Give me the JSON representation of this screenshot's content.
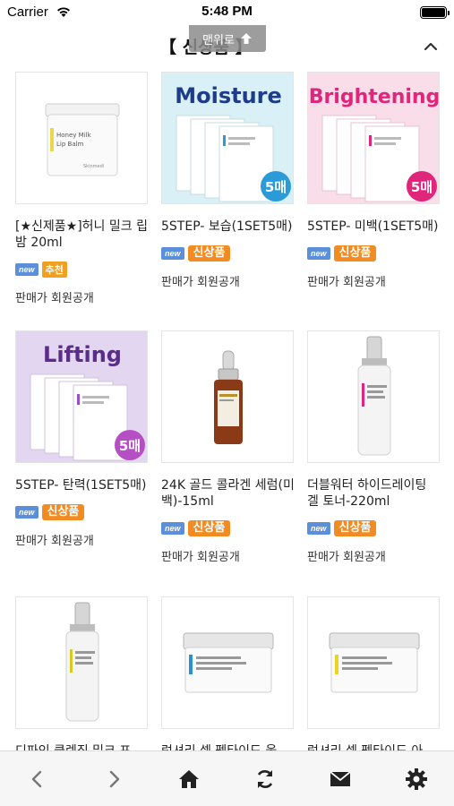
{
  "status_bar": {
    "carrier": "Carrier",
    "time": "5:48 PM"
  },
  "header": {
    "title": "【 신상품 】"
  },
  "to_top": {
    "label": "맨위로"
  },
  "products": [
    {
      "name": "[★신제품★]허니 밀크 립 밤 20ml",
      "badges": [
        "new",
        "추천"
      ],
      "price": "판매가 회원공개",
      "image": {
        "type": "jar",
        "label": "Honey Milk Lip Balm",
        "accent": "#e8d84a"
      }
    },
    {
      "name": "5STEP- 보습(1SET5매)",
      "badges": [
        "new",
        "신상품"
      ],
      "price": "판매가 회원공개",
      "image": {
        "type": "mask",
        "title": "Moisture",
        "bg": "#d8f0f6",
        "title_color": "#1f3c8a",
        "count": "5매"
      }
    },
    {
      "name": "5STEP- 미백(1SET5매)",
      "badges": [
        "new",
        "신상품"
      ],
      "price": "판매가 회원공개",
      "image": {
        "type": "mask",
        "title": "Brightening",
        "bg": "#f9dde9",
        "title_color": "#e0267a",
        "count": "5매"
      }
    },
    {
      "name": "5STEP- 탄력(1SET5매)",
      "badges": [
        "new",
        "신상품"
      ],
      "price": "판매가 회원공개",
      "image": {
        "type": "mask",
        "title": "Lifting",
        "bg": "#e3d6f0",
        "title_color": "#5a2d8a",
        "count": "5매"
      }
    },
    {
      "name": "24K 골드 콜라겐 세럼(미백)-15ml",
      "badges": [
        "new",
        "신상품"
      ],
      "price": "판매가 회원공개",
      "image": {
        "type": "dropper"
      }
    },
    {
      "name": "더블워터 하이드레이팅 겔 토너-220ml",
      "badges": [
        "new",
        "신상품"
      ],
      "price": "판매가 회원공개",
      "image": {
        "type": "bottle",
        "accent": "#e0267a"
      }
    },
    {
      "name": "디파인 클렌징 밀크 포",
      "badges": [],
      "price": "",
      "image": {
        "type": "bottle",
        "accent": "#d8c820"
      }
    },
    {
      "name": "럭셔리 셀 펩타이드 울",
      "badges": [],
      "price": "",
      "image": {
        "type": "wide-jar",
        "accent": "#2b8fd0"
      }
    },
    {
      "name": "럭셔리 셀 펩타이드 아",
      "badges": [],
      "price": "",
      "image": {
        "type": "wide-jar",
        "accent": "#e8d620"
      }
    }
  ],
  "toolbar": {
    "items": [
      {
        "icon": "back-icon"
      },
      {
        "icon": "forward-icon"
      },
      {
        "icon": "home-icon"
      },
      {
        "icon": "refresh-icon"
      },
      {
        "icon": "mail-icon"
      },
      {
        "icon": "gear-icon"
      }
    ]
  }
}
